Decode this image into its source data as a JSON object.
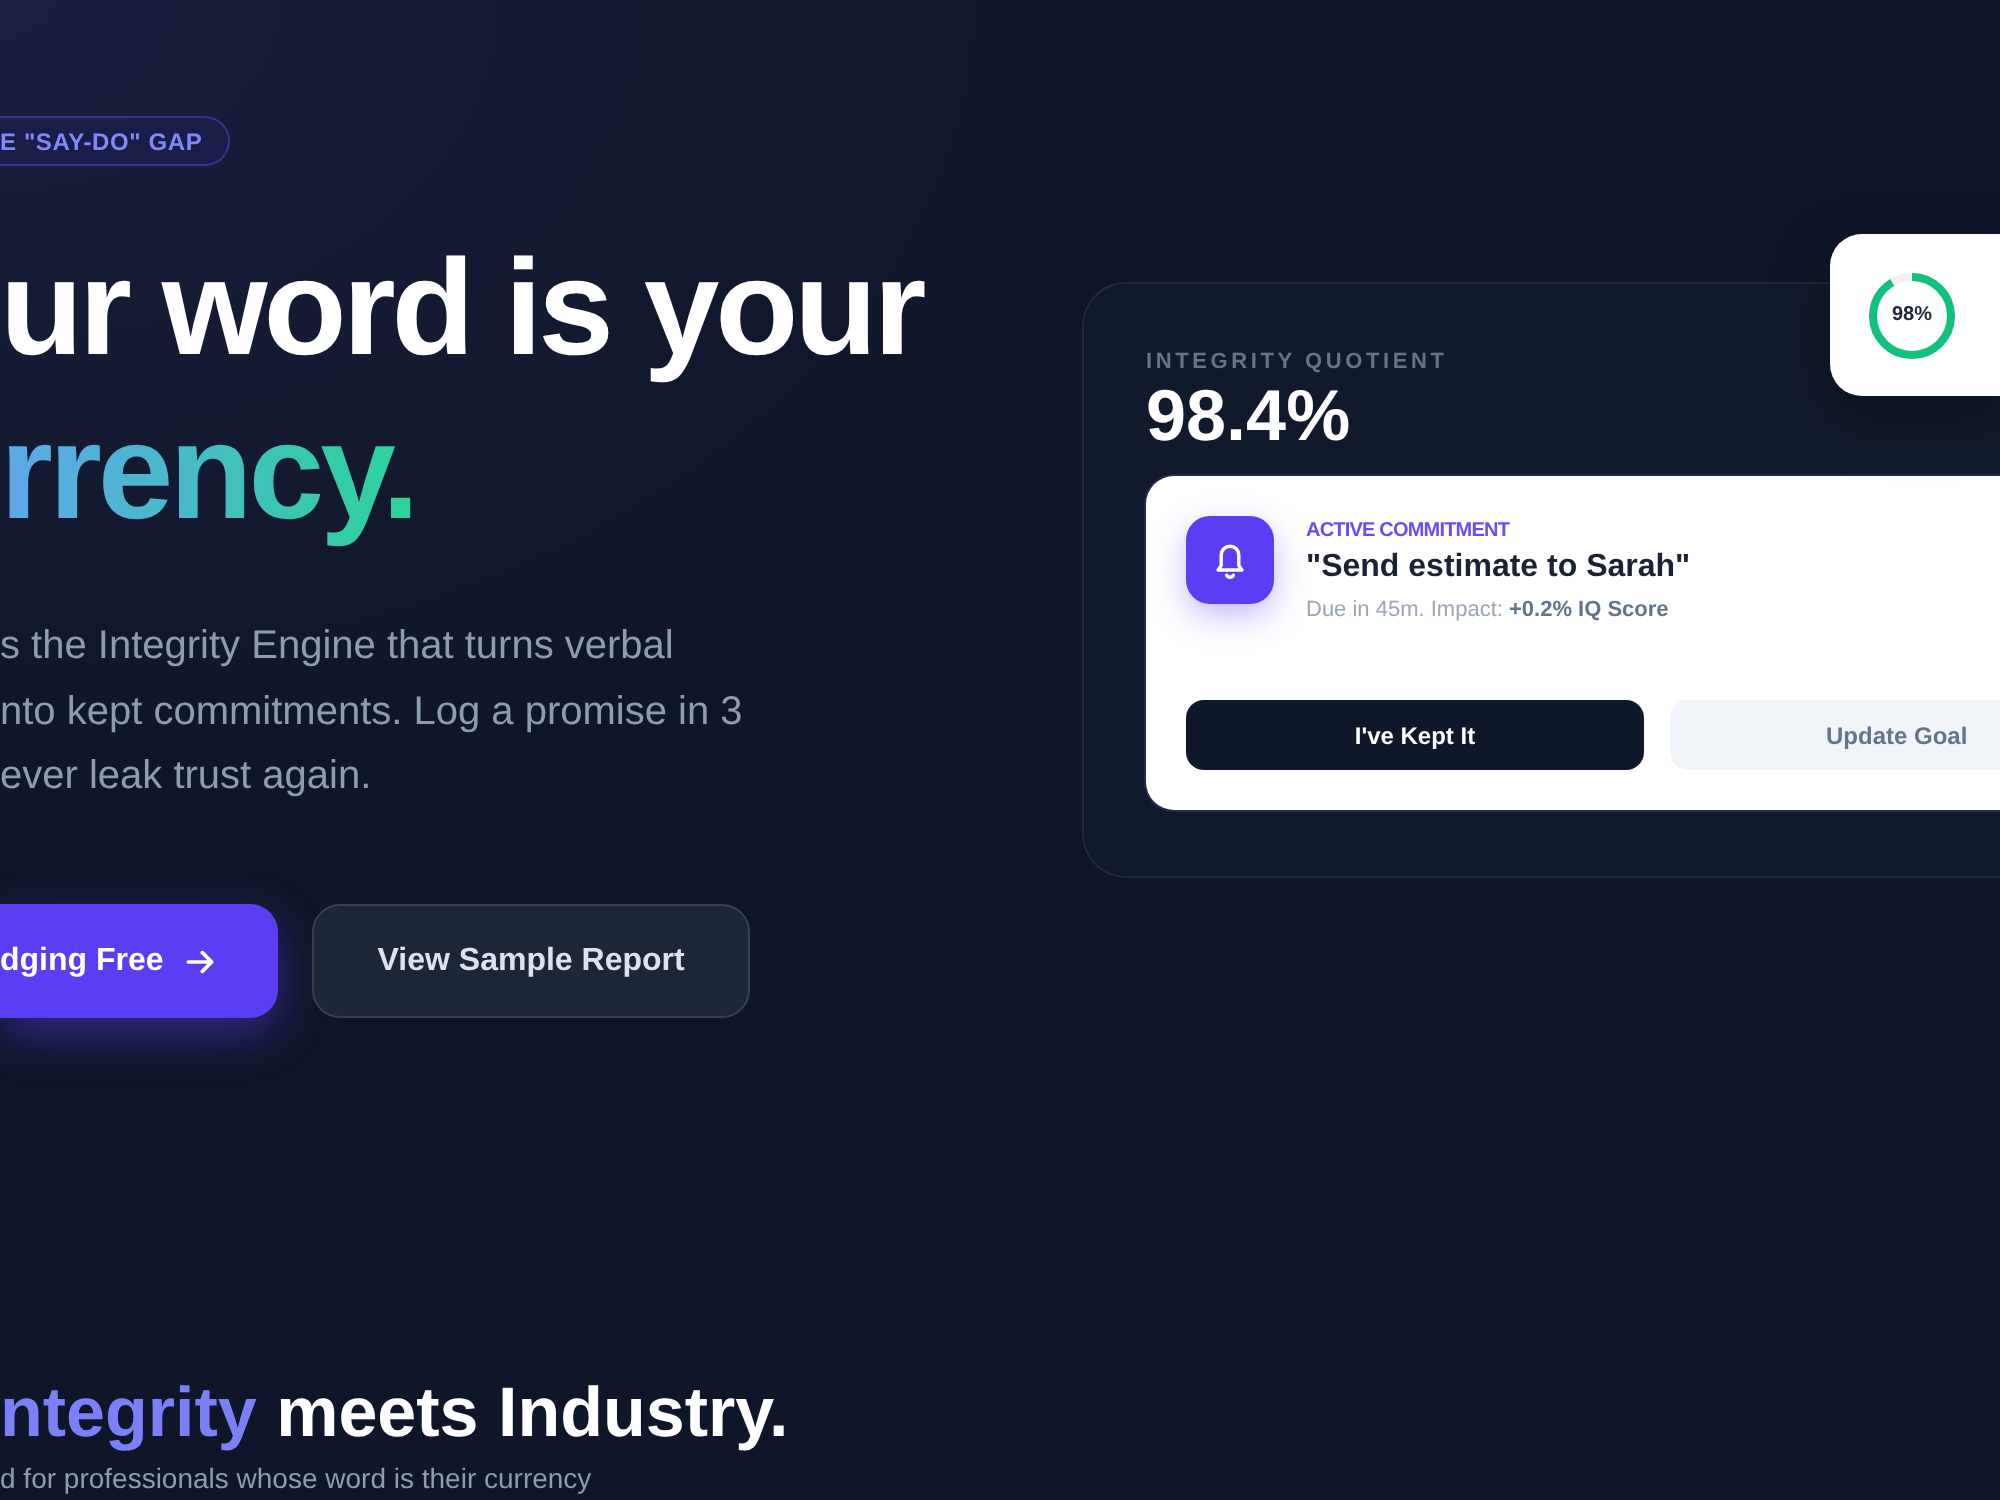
{
  "hero": {
    "badge": "E \"SAY-DO\" GAP",
    "headline": [
      {
        "text": "ur word is your",
        "kind": "plain"
      },
      {
        "text": "rrency.",
        "kind": "gradient"
      }
    ],
    "description_lines": [
      "s the Integrity Engine that turns verbal",
      "nto kept commitments. Log a promise in 3",
      "ever leak trust again."
    ],
    "buttons": [
      {
        "kind": "primary",
        "label": "dging Free"
      },
      {
        "kind": "secondary",
        "label": "View Sample Report"
      }
    ]
  },
  "iq_panel": {
    "label": "INTEGRITY QUOTIENT",
    "value": "98.4%",
    "score_card": {
      "label": "98%",
      "level": 0.92
    },
    "commitment": {
      "tag": "ACTIVE COMMITMENT",
      "title": "\"Send estimate to Sarah\"",
      "detail": "Due in 45m. Impact: **+0.2% IQ Score**",
      "buttons": [
        {
          "kind": "dark",
          "label": "I've Kept It"
        },
        {
          "kind": "light",
          "label": "Update Goal"
        }
      ]
    }
  },
  "section": {
    "heading": [
      {
        "text": "ntegrity",
        "kind": "accent"
      },
      {
        "text": "meets Industry.",
        "kind": "plain"
      }
    ],
    "subtitle": "d for professionals whose word is their currency"
  }
}
